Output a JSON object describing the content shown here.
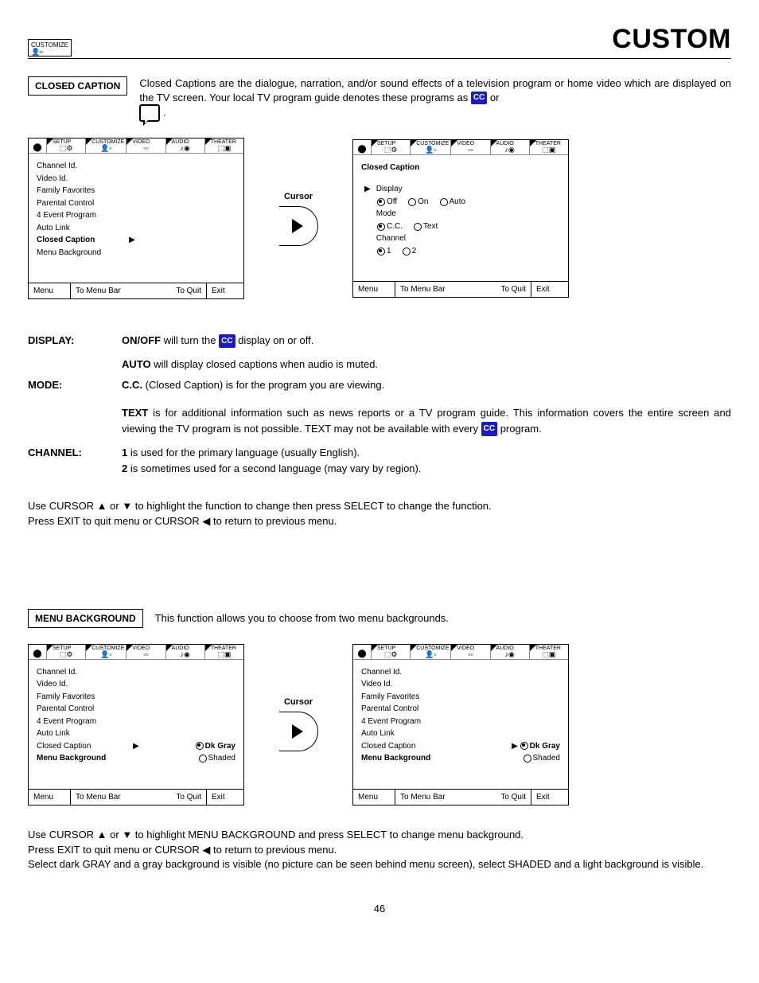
{
  "header": {
    "iconLabel": "CUSTOMIZE",
    "pageTitle": "CUSTOM"
  },
  "section1": {
    "label": "CLOSED CAPTION",
    "intro1": "Closed Captions are the dialogue, narration, and/or sound effects of a television program or home video which are displayed on the TV screen.  Your local TV program guide denotes these programs as ",
    "intro2": " or ",
    "cursorLabel": "Cursor",
    "osdTabs": [
      "SETUP",
      "CUSTOMIZE",
      "VIDEO",
      "AUDIO",
      "THEATER"
    ],
    "osdLeft": {
      "items": [
        "Channel Id.",
        "Video Id.",
        "Family Favorites",
        "Parental Control",
        "4 Event Program",
        "Auto Link",
        "Closed Caption",
        "Menu Background"
      ],
      "highlightIndex": 6
    },
    "osdRight": {
      "title": "Closed Caption",
      "rows": [
        {
          "label": "Display",
          "opts": [
            "Off",
            "On",
            "Auto"
          ],
          "sel": 0,
          "arrow": true
        },
        {
          "label": "Mode",
          "opts": [
            "C.C.",
            "Text"
          ],
          "sel": 0,
          "arrow": false
        },
        {
          "label": "Channel",
          "opts": [
            "1",
            "2"
          ],
          "sel": 0,
          "arrow": false
        }
      ]
    },
    "footer": {
      "c1": "Menu",
      "c2": "To Menu Bar",
      "c3": "To Quit",
      "c4": "Exit"
    },
    "defs": {
      "display": {
        "term": "DISPLAY:",
        "line1a": "ON/OFF",
        "line1b": " will turn the ",
        "line1c": " display on or off.",
        "line2a": "AUTO",
        "line2b": " will display closed captions when audio is muted."
      },
      "mode": {
        "term": "MODE:",
        "line1a": "C.C.",
        "line1b": " (Closed Caption) is for the program you are viewing.",
        "line2a": "TEXT",
        "line2b": " is for additional information such as news reports or a TV program guide.  This information covers the entire screen and viewing the TV program is not possible.  TEXT may not be available with every ",
        "line2c": " program."
      },
      "channel": {
        "term": "CHANNEL:",
        "line1a": "1",
        "line1b": " is used for the primary language (usually English).",
        "line2a": "2",
        "line2b": " is sometimes used for a second language (may vary by region)."
      }
    },
    "nav1": "Use CURSOR ▲ or ▼ to highlight the function to change then press SELECT to change the function.",
    "nav2": "Press EXIT to quit menu or CURSOR ◀ to return to previous menu."
  },
  "section2": {
    "label": "MENU BACKGROUND",
    "intro": "This function allows you to choose from two menu backgrounds.",
    "cursorLabel": "Cursor",
    "osdLeft": {
      "items": [
        "Channel Id.",
        "Video Id.",
        "Family Favorites",
        "Parental Control",
        "4 Event Program",
        "Auto Link",
        "Closed Caption",
        "Menu Background"
      ],
      "highlightIndex": 7,
      "sideOpts": [
        "Dk Gray",
        "Shaded"
      ],
      "sideSel": 0,
      "arrowRow": 6
    },
    "osdRight": {
      "items": [
        "Channel Id.",
        "Video Id.",
        "Family Favorites",
        "Parental Control",
        "4 Event Program",
        "Auto Link",
        "Closed Caption",
        "Menu Background"
      ],
      "highlightIndex": 7,
      "sideOpts": [
        "Dk Gray",
        "Shaded"
      ],
      "sideSel": 0,
      "arrowRow": 6
    },
    "nav1": "Use CURSOR ▲ or ▼ to highlight MENU BACKGROUND and press SELECT to change menu background.",
    "nav2": "Press EXIT to quit menu or CURSOR ◀ to return to previous menu.",
    "nav3": "Select dark GRAY and a gray background is visible (no picture can be seen behind menu screen), select SHADED and a light background is visible."
  },
  "pageNumber": "46",
  "ccBadge": "CC"
}
